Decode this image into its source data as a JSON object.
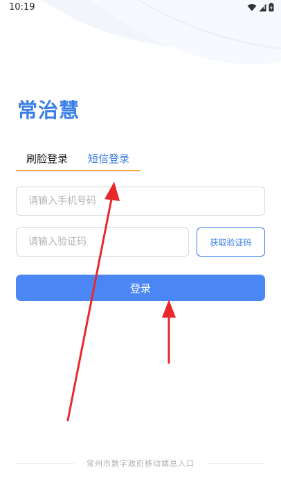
{
  "status_bar": {
    "time": "10:19"
  },
  "logo": {
    "text": "常治慧"
  },
  "tabs": [
    {
      "label": "刷脸登录"
    },
    {
      "label": "短信登录"
    }
  ],
  "form": {
    "phone_placeholder": "请输入手机号码",
    "code_placeholder": "请输入验证码",
    "get_code_label": "获取验证码",
    "login_label": "登录"
  },
  "footer": {
    "text": "常州市数字政府移动端总入口"
  },
  "colors": {
    "brand_blue": "#3a7ee8",
    "login_button": "#4a87f5",
    "tab_underline": "#f2a541",
    "annotation_arrow": "#e8282b"
  }
}
